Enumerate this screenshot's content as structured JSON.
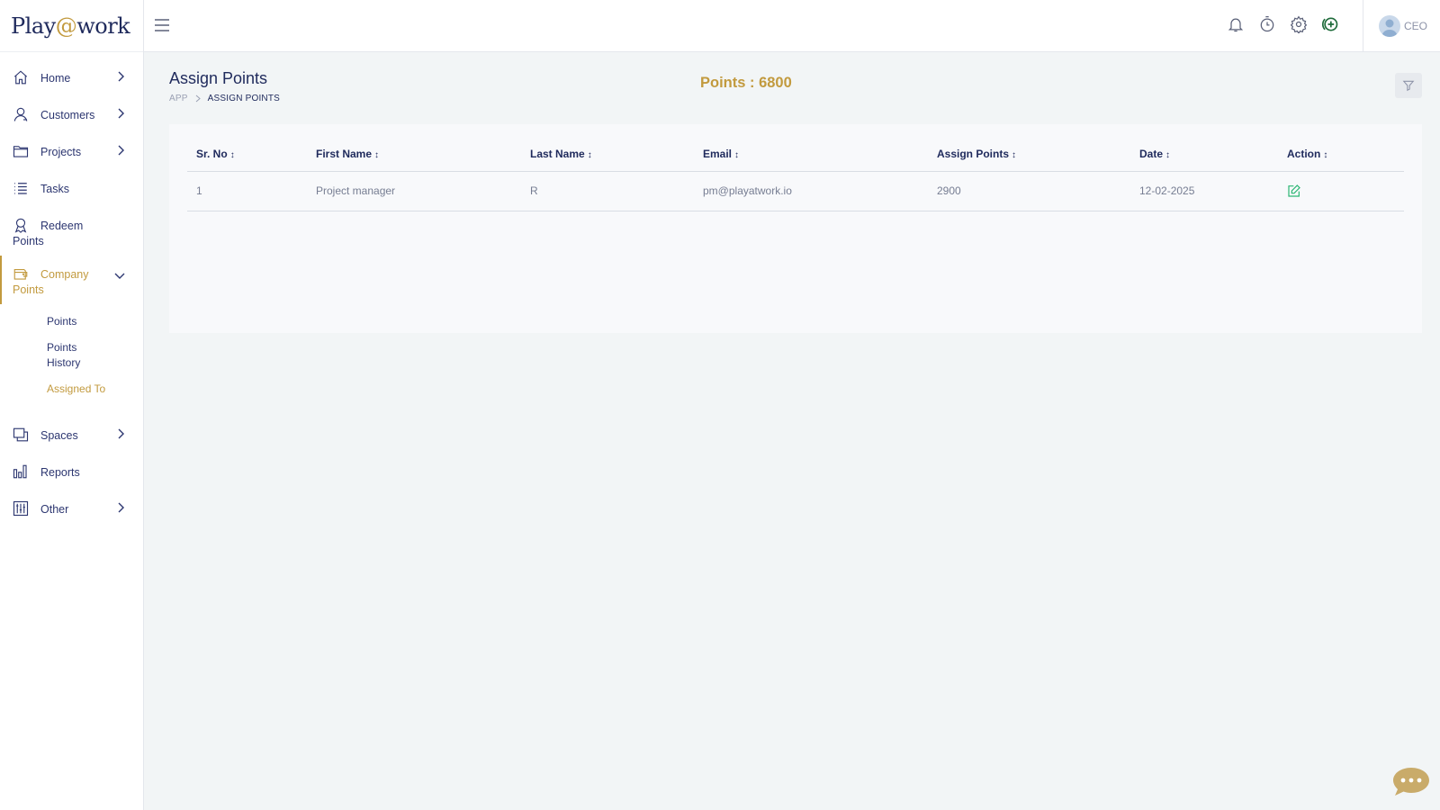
{
  "brand": {
    "logo_left": "Play",
    "logo_at": "@",
    "logo_right": "work"
  },
  "sidebar": {
    "items": [
      {
        "label": "Home",
        "icon": "home-icon",
        "has_chevron": true
      },
      {
        "label": "Customers",
        "icon": "customers-icon",
        "has_chevron": true
      },
      {
        "label": "Projects",
        "icon": "folder-icon",
        "has_chevron": true
      },
      {
        "label": "Tasks",
        "icon": "list-icon",
        "has_chevron": false
      },
      {
        "label_line1": "Redeem",
        "label_line2": "Points",
        "icon": "award-icon"
      },
      {
        "label_line1": "Company",
        "label_line2": "Points",
        "icon": "wallet-icon",
        "expanded": true
      },
      {
        "label": "Spaces",
        "icon": "spaces-icon",
        "has_chevron": true
      },
      {
        "label": "Reports",
        "icon": "bar-chart-icon",
        "has_chevron": false
      },
      {
        "label": "Other",
        "icon": "sliders-icon",
        "has_chevron": true
      }
    ],
    "company_points_sub": [
      {
        "label": "Points"
      },
      {
        "label_line1": "Points",
        "label_line2": "History"
      },
      {
        "label": "Assigned To"
      }
    ]
  },
  "header": {
    "icons": [
      "bell-icon",
      "timer-icon",
      "gear-icon",
      "add-circle-icon"
    ],
    "user_name": "CEO"
  },
  "page": {
    "title": "Assign Points",
    "breadcrumb": [
      "APP",
      "ASSIGN POINTS"
    ],
    "points_label": "Points : 6800"
  },
  "table": {
    "columns": [
      "Sr. No",
      "First Name",
      "Last Name",
      "Email",
      "Assign Points",
      "Date",
      "Action"
    ],
    "rows": [
      {
        "sr": "1",
        "first": "Project manager",
        "last": "R",
        "email": "pm@playatwork.io",
        "points": "2900",
        "date": "12-02-2025"
      }
    ]
  },
  "colors": {
    "accent": "#c29a3e",
    "navy": "#1f2a5c",
    "edit_green": "#2bb673",
    "page_bg": "#f2f5f6"
  }
}
